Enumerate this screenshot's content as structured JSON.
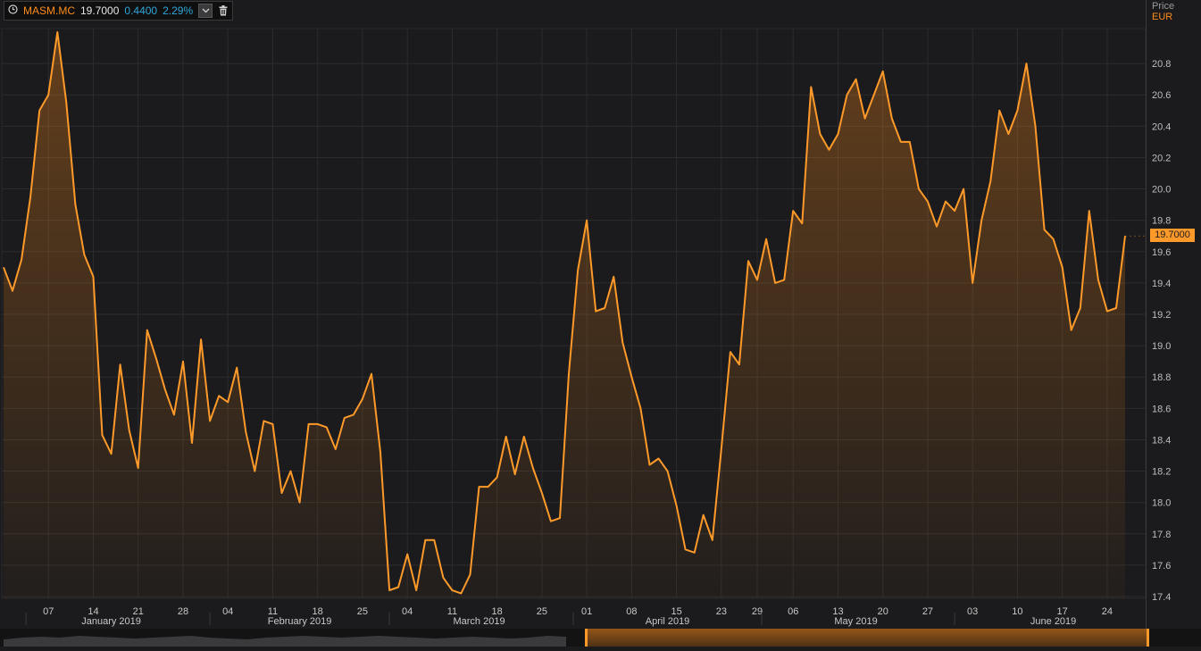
{
  "legend": {
    "symbol": "MASM.MC",
    "last": "19.7000",
    "change": "0.4400",
    "change_pct": "2.29%",
    "clock_icon": "clock-icon",
    "dropdown_icon": "chevron-down-icon",
    "delete_icon": "trash-icon"
  },
  "axis_header": {
    "price_label": "Price",
    "currency": "EUR"
  },
  "last_value_tag": "19.7000",
  "colors": {
    "line": "#ff9a2a",
    "fill": "#ff8c1a",
    "bg": "#1b1b1d",
    "grid": "#2c2c2e",
    "change": "#2ea7d8",
    "symbol": "#ff8c1a"
  },
  "chart_data": {
    "type": "area",
    "series": [
      {
        "name": "MASM.MC",
        "values": [
          19.5,
          19.35,
          19.55,
          19.95,
          20.5,
          20.6,
          21.0,
          20.55,
          19.9,
          19.58,
          19.44,
          18.43,
          18.31,
          18.88,
          18.46,
          18.22,
          19.1,
          18.92,
          18.72,
          18.56,
          18.9,
          18.38,
          19.04,
          18.52,
          18.68,
          18.64,
          18.86,
          18.45,
          18.2,
          18.52,
          18.5,
          18.06,
          18.2,
          18.0,
          18.5,
          18.5,
          18.48,
          18.34,
          18.54,
          18.56,
          18.66,
          18.82,
          18.32,
          17.44,
          17.46,
          17.67,
          17.44,
          17.76,
          17.76,
          17.52,
          17.44,
          17.42,
          17.54,
          18.1,
          18.1,
          18.16,
          18.42,
          18.18,
          18.42,
          18.22,
          18.06,
          17.88,
          17.9,
          18.82,
          19.48,
          19.8,
          19.22,
          19.24,
          19.44,
          19.02,
          18.8,
          18.6,
          18.24,
          18.28,
          18.2,
          17.98,
          17.7,
          17.68,
          17.92,
          17.76,
          18.34,
          18.96,
          18.88,
          19.54,
          19.42,
          19.68,
          19.4,
          19.42,
          19.86,
          19.78,
          20.65,
          20.35,
          20.25,
          20.35,
          20.6,
          20.7,
          20.45,
          20.6,
          20.75,
          20.45,
          20.3,
          20.3,
          20.0,
          19.92,
          19.76,
          19.92,
          19.86,
          20.0,
          19.4,
          19.8,
          20.05,
          20.5,
          20.35,
          20.5,
          20.8,
          20.4,
          19.74,
          19.68,
          19.5,
          19.1,
          19.24,
          19.86,
          19.42,
          19.22,
          19.24,
          19.7
        ]
      }
    ],
    "y_ticks": [
      "17.4",
      "17.6",
      "17.8",
      "18.0",
      "18.2",
      "18.4",
      "18.6",
      "18.8",
      "19.0",
      "19.2",
      "19.4",
      "19.6",
      "19.8",
      "20.0",
      "20.2",
      "20.4",
      "20.6",
      "20.8"
    ],
    "ylim": [
      17.4,
      21.0
    ],
    "x_day_ticks": [
      {
        "label": "07",
        "i": 5
      },
      {
        "label": "14",
        "i": 10
      },
      {
        "label": "21",
        "i": 15
      },
      {
        "label": "28",
        "i": 20
      },
      {
        "label": "04",
        "i": 25
      },
      {
        "label": "11",
        "i": 30
      },
      {
        "label": "18",
        "i": 35
      },
      {
        "label": "25",
        "i": 40
      },
      {
        "label": "04",
        "i": 45
      },
      {
        "label": "11",
        "i": 50
      },
      {
        "label": "18",
        "i": 55
      },
      {
        "label": "25",
        "i": 60
      },
      {
        "label": "01",
        "i": 65
      },
      {
        "label": "08",
        "i": 70
      },
      {
        "label": "15",
        "i": 75
      },
      {
        "label": "23",
        "i": 80
      },
      {
        "label": "29",
        "i": 84
      },
      {
        "label": "06",
        "i": 88
      },
      {
        "label": "13",
        "i": 93
      },
      {
        "label": "20",
        "i": 98
      },
      {
        "label": "27",
        "i": 103
      },
      {
        "label": "03",
        "i": 108
      },
      {
        "label": "10",
        "i": 113
      },
      {
        "label": "17",
        "i": 118
      },
      {
        "label": "24",
        "i": 123
      }
    ],
    "x_month_labels": [
      {
        "label": "January 2019",
        "i": 12
      },
      {
        "label": "February 2019",
        "i": 33
      },
      {
        "label": "March 2019",
        "i": 53
      },
      {
        "label": "April 2019",
        "i": 74
      },
      {
        "label": "May 2019",
        "i": 95
      },
      {
        "label": "June 2019",
        "i": 117
      }
    ],
    "month_separators": [
      2.5,
      23,
      43,
      63.5,
      84.5,
      106
    ],
    "grid": true,
    "legend_position": "top-left"
  }
}
